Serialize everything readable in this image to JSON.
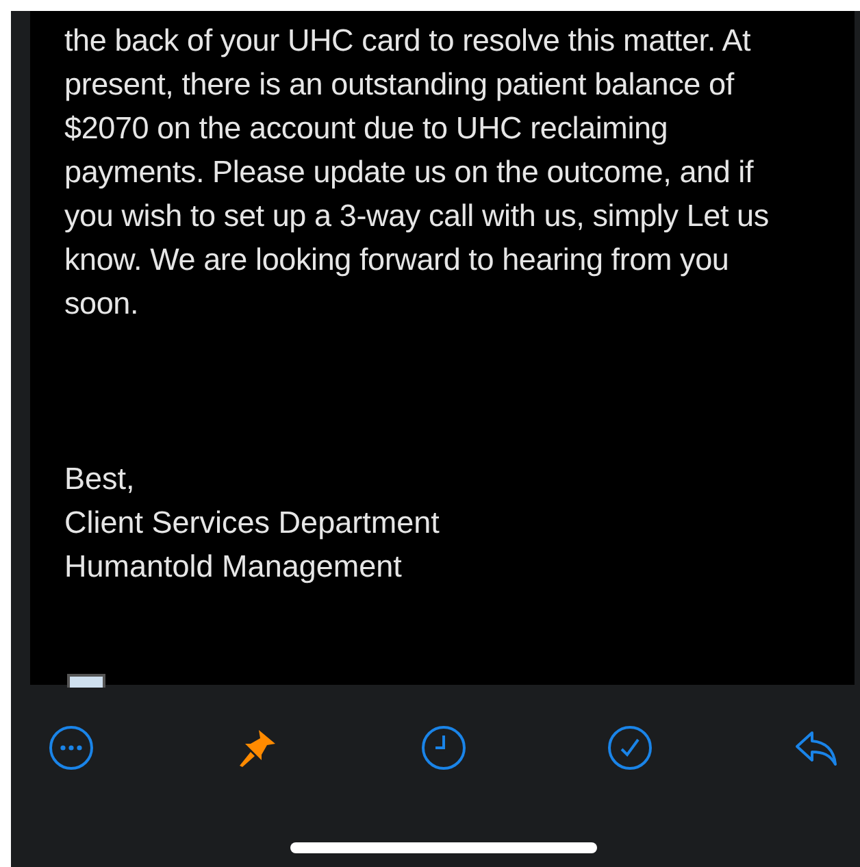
{
  "message": {
    "paragraph": "the back of your UHC card to resolve this matter. At present, there is an outstanding patient balance of $2070 on the account due to UHC reclaiming payments. Please update us on the outcome, and if you wish to set up a 3-way call with us, simply Let us know. We are looking forward to hearing from you soon.",
    "signature": [
      "Best,",
      "Client Services Department",
      "Humantold Management"
    ]
  },
  "toolbar": [
    {
      "kind": "more",
      "on": false
    },
    {
      "kind": "pin",
      "on": true
    },
    {
      "kind": "remind",
      "on": false
    },
    {
      "kind": "done",
      "on": false
    },
    {
      "kind": "reply",
      "on": false
    }
  ]
}
